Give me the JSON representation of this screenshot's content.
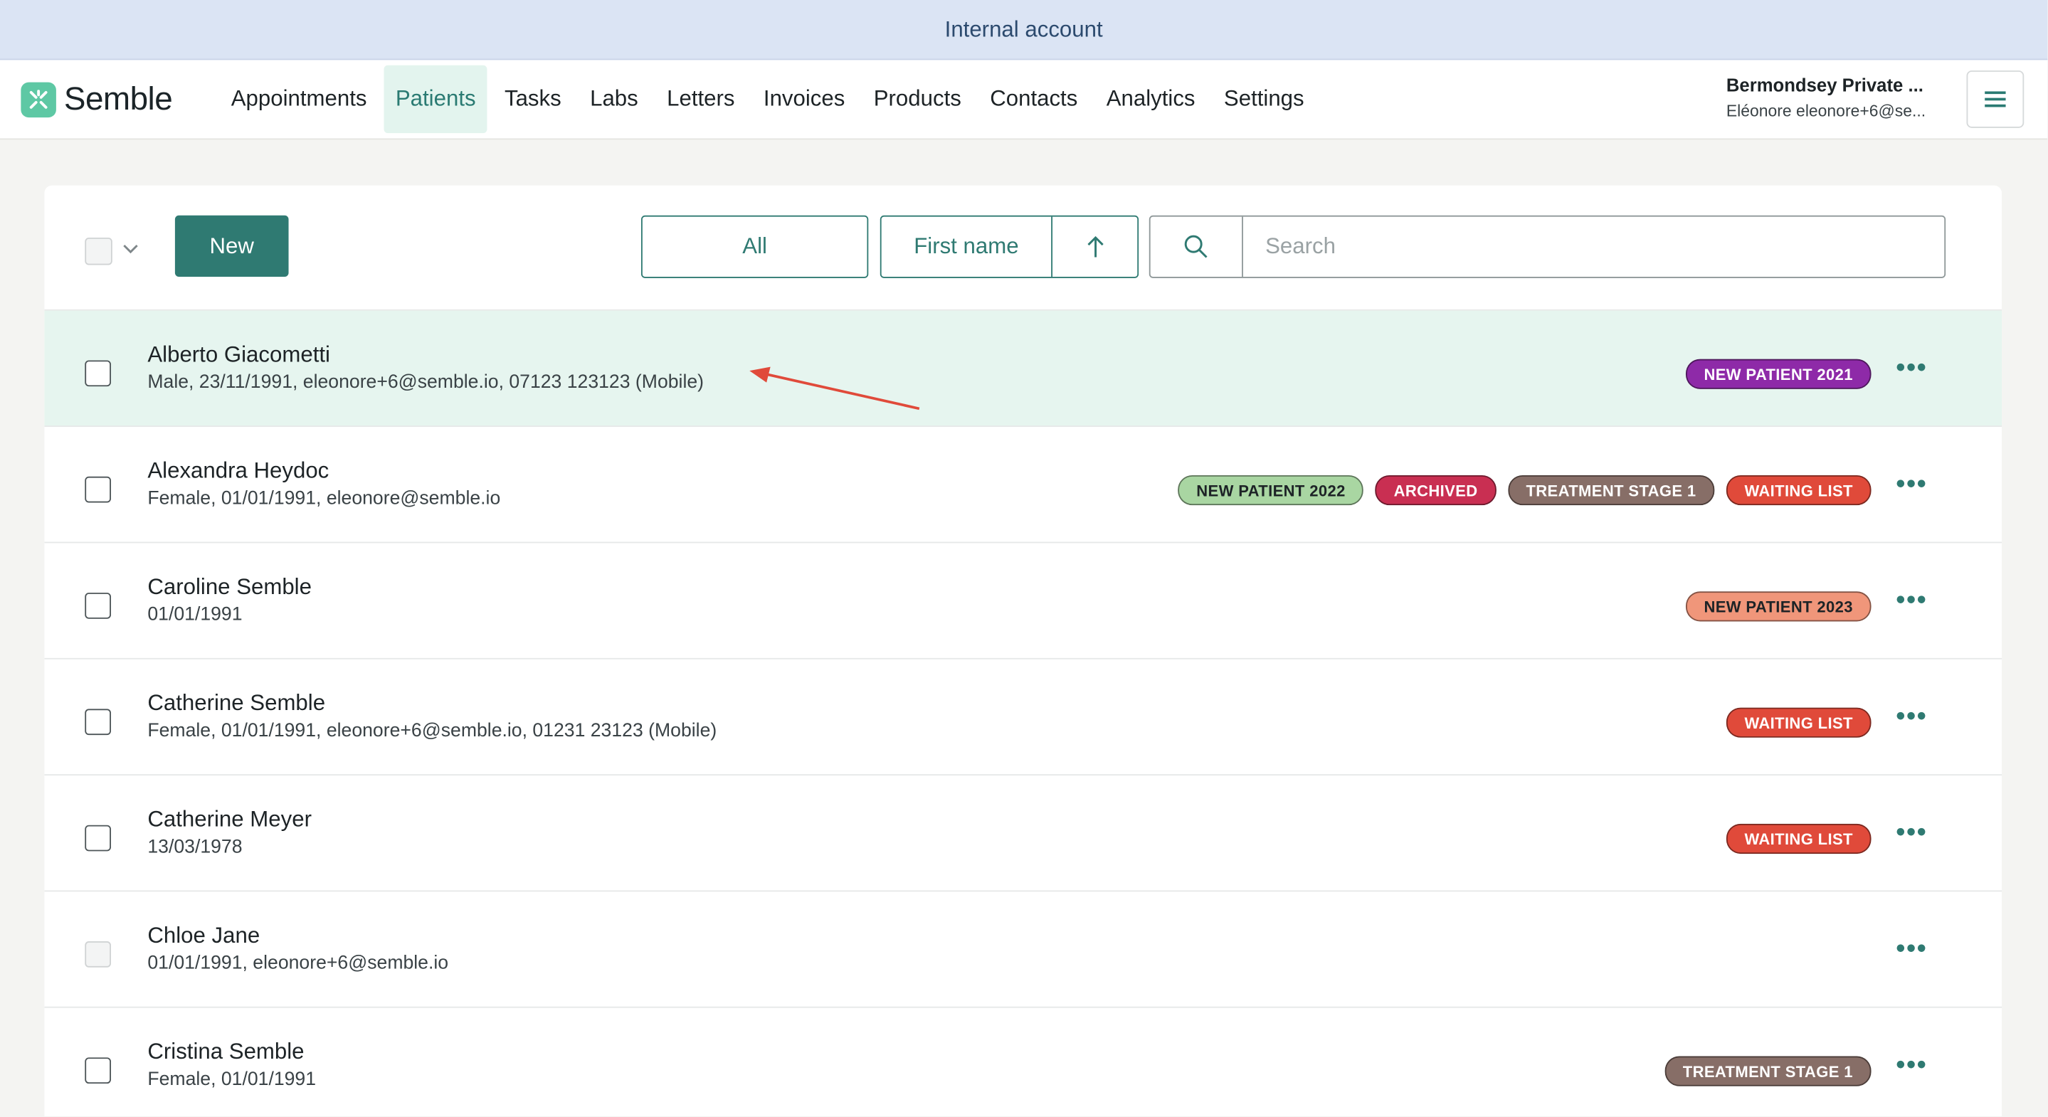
{
  "banner": {
    "text": "Internal account"
  },
  "brand": {
    "name": "Semble",
    "accent": "#5ec8a4"
  },
  "nav": {
    "items": [
      {
        "label": "Appointments",
        "active": false
      },
      {
        "label": "Patients",
        "active": true
      },
      {
        "label": "Tasks",
        "active": false
      },
      {
        "label": "Labs",
        "active": false
      },
      {
        "label": "Letters",
        "active": false
      },
      {
        "label": "Invoices",
        "active": false
      },
      {
        "label": "Products",
        "active": false
      },
      {
        "label": "Contacts",
        "active": false
      },
      {
        "label": "Analytics",
        "active": false
      },
      {
        "label": "Settings",
        "active": false
      }
    ]
  },
  "account": {
    "name": "Bermondsey Private ...",
    "email": "Eléonore eleonore+6@se..."
  },
  "toolbar": {
    "new_label": "New",
    "filter_label": "All",
    "sort_field": "First name",
    "sort_direction_icon": "arrow-up-icon",
    "search_placeholder": "Search",
    "search_value": ""
  },
  "patients": [
    {
      "name": "Alberto Giacometti",
      "details": "Male, 23/11/1991, eleonore+6@semble.io, 07123 123123 (Mobile)",
      "highlighted": true,
      "checkbox_disabled": false,
      "tags": [
        {
          "label": "NEW PATIENT 2021",
          "bg": "#8e2aa8",
          "fg": "#ffffff"
        }
      ]
    },
    {
      "name": "Alexandra Heydoc",
      "details": "Female, 01/01/1991, eleonore@semble.io",
      "highlighted": false,
      "checkbox_disabled": false,
      "tags": [
        {
          "label": "NEW PATIENT 2022",
          "bg": "#a9d6a2",
          "fg": "#1d2326"
        },
        {
          "label": "ARCHIVED",
          "bg": "#c92f52",
          "fg": "#ffffff"
        },
        {
          "label": "TREATMENT STAGE 1",
          "bg": "#876e67",
          "fg": "#ffffff"
        },
        {
          "label": "WAITING LIST",
          "bg": "#e04a3a",
          "fg": "#ffffff"
        }
      ]
    },
    {
      "name": "Caroline Semble",
      "details": "01/01/1991",
      "highlighted": false,
      "checkbox_disabled": false,
      "tags": [
        {
          "label": "NEW PATIENT 2023",
          "bg": "#f0967a",
          "fg": "#1d2326"
        }
      ]
    },
    {
      "name": "Catherine Semble",
      "details": "Female, 01/01/1991, eleonore+6@semble.io, 01231 23123 (Mobile)",
      "highlighted": false,
      "checkbox_disabled": false,
      "tags": [
        {
          "label": "WAITING LIST",
          "bg": "#e04a3a",
          "fg": "#ffffff"
        }
      ]
    },
    {
      "name": "Catherine Meyer",
      "details": "13/03/1978",
      "highlighted": false,
      "checkbox_disabled": false,
      "tags": [
        {
          "label": "WAITING LIST",
          "bg": "#e04a3a",
          "fg": "#ffffff"
        }
      ]
    },
    {
      "name": "Chloe Jane",
      "details": "01/01/1991, eleonore+6@semble.io",
      "highlighted": false,
      "checkbox_disabled": true,
      "tags": []
    },
    {
      "name": "Cristina Semble",
      "details": "Female, 01/01/1991",
      "highlighted": false,
      "checkbox_disabled": false,
      "tags": [
        {
          "label": "TREATMENT STAGE 1",
          "bg": "#876e67",
          "fg": "#ffffff"
        }
      ]
    }
  ],
  "row_more_label": "•••",
  "annotation": {
    "color": "#e04a3a"
  }
}
